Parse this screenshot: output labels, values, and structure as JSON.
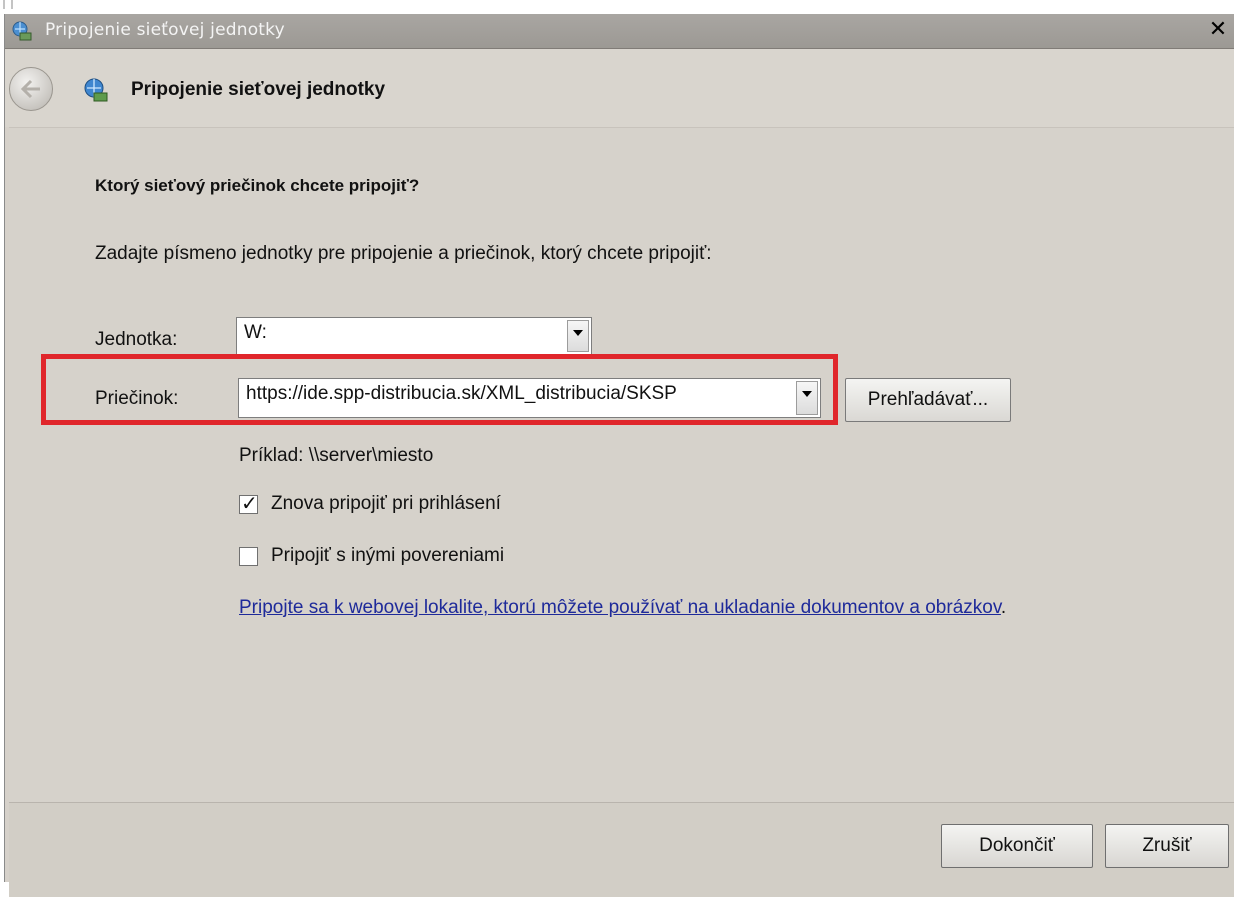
{
  "window": {
    "title": "Pripojenie sieťovej jednotky",
    "close_label": "✕"
  },
  "nav": {
    "back_icon": "back-arrow-icon",
    "title": "Pripojenie sieťovej jednotky"
  },
  "content": {
    "heading": "Ktorý sieťový priečinok chcete pripojiť?",
    "instructions": "Zadajte písmeno jednotky pre pripojenie a priečinok, ktorý chcete pripojiť:",
    "drive_label": "Jednotka:",
    "drive_value": "W:",
    "folder_label": "Priečinok:",
    "folder_value": "https://ide.spp-distribucia.sk/XML_distribucia/SKSP",
    "browse_label": "Prehľadávať...",
    "example": "Príklad: \\\\server\\miesto",
    "reconnect": {
      "label": "Znova pripojiť pri prihlásení",
      "checked": true
    },
    "other_credentials": {
      "label": "Pripojiť s inými povereniami",
      "checked": false
    },
    "link_text": "Pripojte sa k webovej lokalite, ktorú môžete používať na ukladanie dokumentov a obrázkov",
    "link_suffix": "."
  },
  "footer": {
    "finish_label": "Dokončiť",
    "cancel_label": "Zrušiť"
  },
  "colors": {
    "highlight": "#e0262b",
    "link": "#1e2a9a",
    "titlebar": "#a9a6a2"
  }
}
